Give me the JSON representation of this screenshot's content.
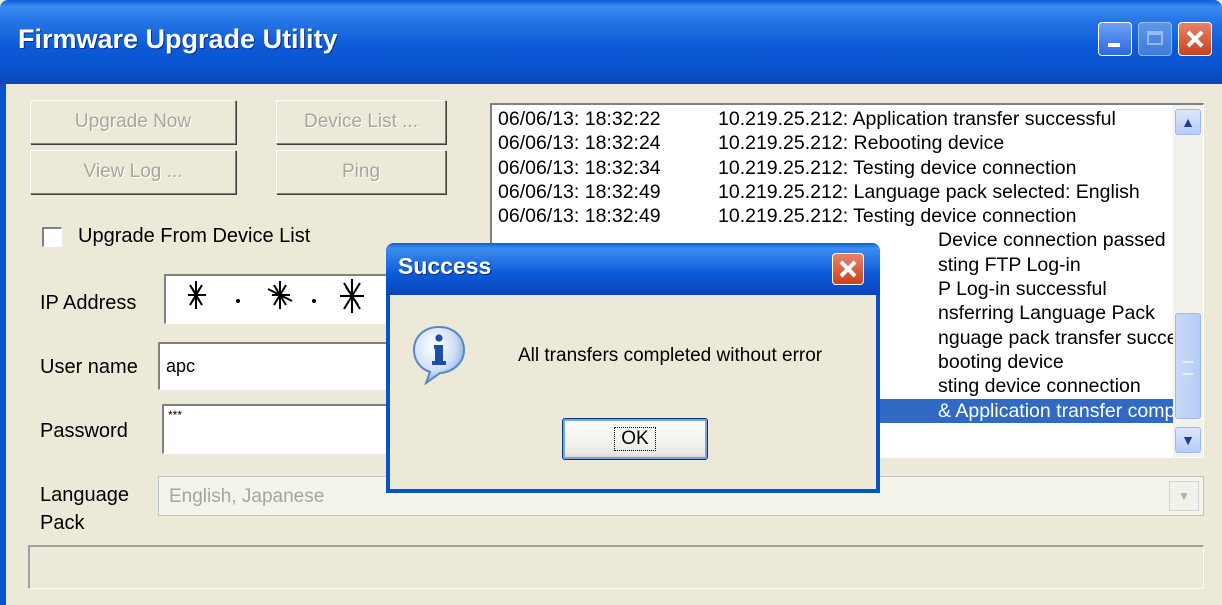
{
  "window": {
    "title": "Firmware Upgrade Utility"
  },
  "buttons": {
    "upgrade_now": "Upgrade Now",
    "device_list": "Device List ...",
    "view_log": "View Log ...",
    "ping": "Ping"
  },
  "checkbox": {
    "label": "Upgrade From Device List",
    "checked": false
  },
  "form": {
    "ip_label": "IP Address",
    "user_label": "User name",
    "user_value": "apc",
    "password_label": "Password",
    "password_value": "***",
    "language_label": "Language Pack",
    "language_value": "English, Japanese"
  },
  "log": {
    "lines": [
      {
        "time": "06/06/13: 18:32:22",
        "text": "10.219.25.212: Application transfer successful"
      },
      {
        "time": "06/06/13: 18:32:24",
        "text": "10.219.25.212: Rebooting device"
      },
      {
        "time": "06/06/13: 18:32:34",
        "text": "10.219.25.212: Testing device connection"
      },
      {
        "time": "06/06/13: 18:32:49",
        "text": "10.219.25.212: Language pack selected: English"
      },
      {
        "time": "06/06/13: 18:32:49",
        "text": "10.219.25.212: Testing device connection"
      },
      {
        "time": "",
        "text": "Device connection passed"
      },
      {
        "time": "",
        "text": "sting FTP Log-in"
      },
      {
        "time": "",
        "text": "P Log-in successful"
      },
      {
        "time": "",
        "text": "nsferring Language Pack"
      },
      {
        "time": "",
        "text": "nguage pack transfer successf"
      },
      {
        "time": "",
        "text": "booting device"
      },
      {
        "time": "",
        "text": "sting device connection"
      },
      {
        "time": "",
        "text": "& Application transfer complete"
      }
    ],
    "selected_index": 12
  },
  "dialog": {
    "title": "Success",
    "message": "All transfers completed without error",
    "ok": "OK",
    "icon": "information-icon"
  },
  "colors": {
    "title_bar": "#0a52cc",
    "selection": "#316ac5",
    "face": "#ece9d8"
  }
}
